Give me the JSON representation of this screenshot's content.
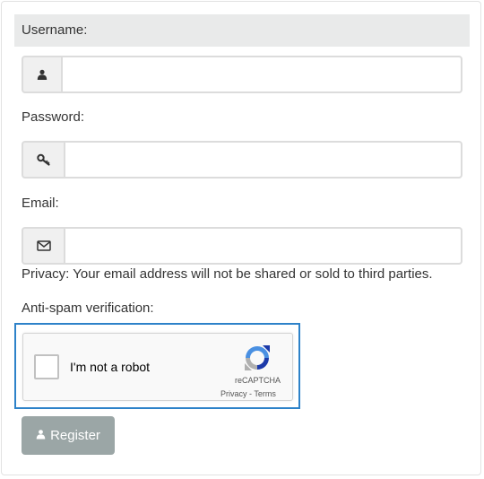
{
  "form": {
    "username_label": "Username:",
    "password_label": "Password:",
    "email_label": "Email:",
    "privacy_note": "Privacy: Your email address will not be shared or sold to third parties.",
    "antispam_label": "Anti-spam verification:",
    "username_value": "",
    "password_value": "",
    "email_value": ""
  },
  "captcha": {
    "checkbox_label": "I'm not a robot",
    "brand": "reCAPTCHA",
    "privacy_link": "Privacy",
    "separator": " - ",
    "terms_link": "Terms"
  },
  "register_button": {
    "label": "Register",
    "icon": "user-icon"
  },
  "icons": {
    "username": "user-icon",
    "password": "key-icon",
    "email": "envelope-icon"
  },
  "colors": {
    "highlight_bg": "#e9eaea",
    "captcha_focus_border": "#2d82c9",
    "button_bg": "#9ba6a6"
  }
}
